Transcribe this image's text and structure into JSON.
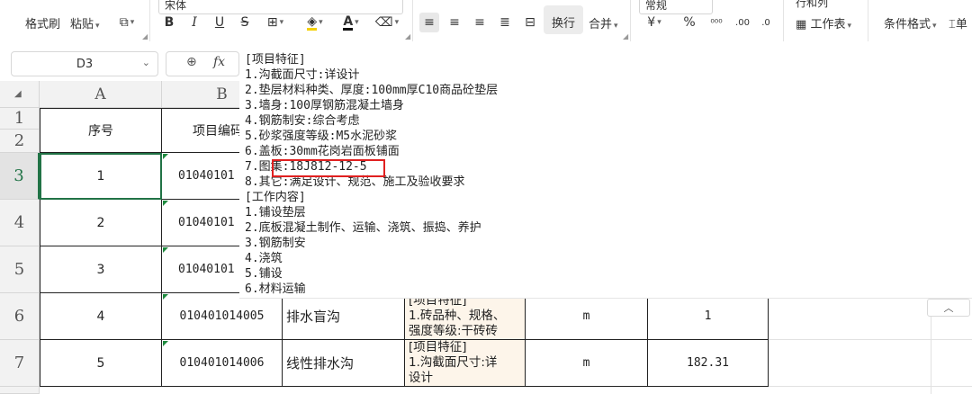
{
  "ribbon": {
    "format_painter": "格式刷",
    "paste": "粘贴",
    "font_name": "宋体",
    "bold": "B",
    "italic": "I",
    "underline": "U",
    "strike": "S",
    "wrap": "换行",
    "merge": "合并",
    "number_format": "常规",
    "currency": "¥",
    "percent": "%",
    "row_col": "行和列",
    "table_style": "工作表",
    "cond_format": "条件格式",
    "freeze": "单"
  },
  "formula_bar": {
    "cell_ref": "D3",
    "fx": "fx"
  },
  "columns": [
    "A",
    "B"
  ],
  "rows": [
    {
      "num": "1",
      "seq": "",
      "code": "",
      "name": "",
      "desc": "",
      "unit": "",
      "qty": ""
    },
    {
      "num": "2",
      "seq": "",
      "code": "",
      "name": "",
      "desc": "",
      "unit": "",
      "qty": ""
    },
    {
      "num": "3",
      "seq": "1",
      "code": "01040101",
      "name": "",
      "desc": "",
      "unit": "",
      "qty": ""
    },
    {
      "num": "4",
      "seq": "2",
      "code": "01040101",
      "name": "",
      "desc": "",
      "unit": "",
      "qty": ""
    },
    {
      "num": "5",
      "seq": "3",
      "code": "01040101",
      "name": "",
      "desc": "",
      "unit": "",
      "qty": ""
    },
    {
      "num": "6",
      "seq": "4",
      "code": "010401014005",
      "name": "排水盲沟",
      "desc": "[项目特征]\n1.砖品种、规格、\n强度等级:干砖砖",
      "unit": "m",
      "qty": "1"
    },
    {
      "num": "7",
      "seq": "5",
      "code": "010401014006",
      "name": "线性排水沟",
      "desc": "[项目特征]\n1.沟截面尺寸:详\n设计",
      "unit": "m",
      "qty": "182.31"
    }
  ],
  "header_row": {
    "seq": "序号",
    "code": "项目编码"
  },
  "popup": {
    "lines": [
      "[项目特征]",
      "1.沟截面尺寸:详设计",
      "2.垫层材料种类、厚度:100mm厚C10商品砼垫层",
      "3.墙身:100厚钢筋混凝土墙身",
      "4.钢筋制安:综合考虑",
      "5.砂浆强度等级:M5水泥砂浆",
      "6.盖板:30mm花岗岩面板铺面",
      "7.图集:18J812-12-5",
      "8.其它:满足设计、规范、施工及验收要求",
      "[工作内容]",
      "1.铺设垫层",
      "2.底板混凝土制作、运输、浇筑、振捣、养护",
      "3.钢筋制安",
      "4.浇筑",
      "5.铺设",
      "6.材料运输"
    ]
  },
  "colors": {
    "accent": "#217346",
    "highlight": "#e02020"
  }
}
